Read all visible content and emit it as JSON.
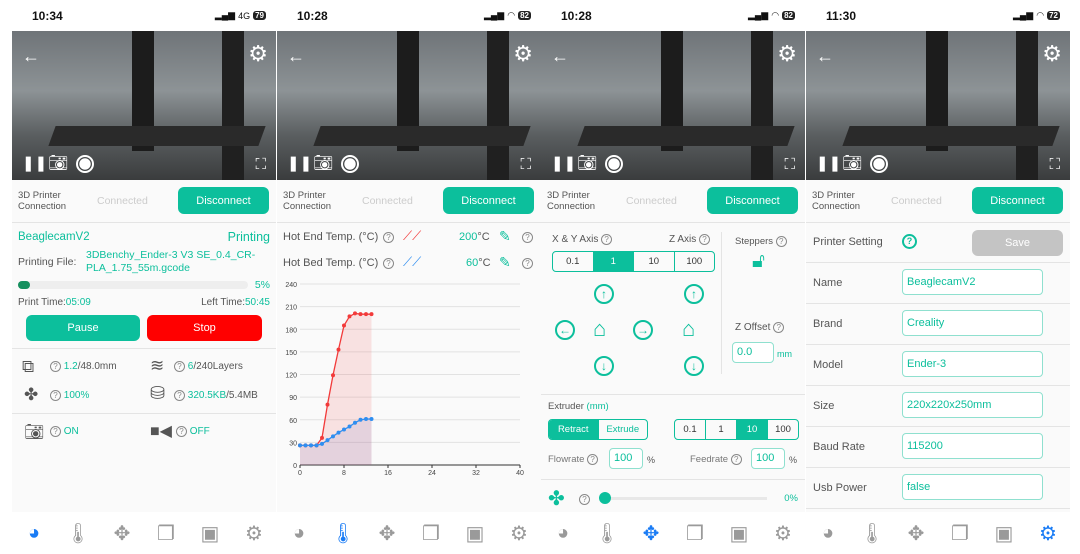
{
  "colors": {
    "accent": "#0cbf9c",
    "stop": "#ff0000",
    "nav_active": "#1a7cf5",
    "hot_end": "#f23a3a",
    "hot_bed": "#2f8ef0"
  },
  "common": {
    "conn_label": "3D Printer Connection",
    "connected": "Connected",
    "disconnect": "Disconnect",
    "nav": [
      "dashboard-icon",
      "thermometer-icon",
      "move-icon",
      "files-icon",
      "video-file-icon",
      "settings-icon"
    ]
  },
  "screens": [
    {
      "time": "10:34",
      "network": "4G",
      "battery": "79",
      "active_nav": 0
    },
    {
      "time": "10:28",
      "network": "wifi",
      "battery": "82",
      "active_nav": 1
    },
    {
      "time": "10:28",
      "network": "wifi",
      "battery": "82",
      "active_nav": 2
    },
    {
      "time": "11:30",
      "network": "wifi",
      "battery": "72",
      "active_nav": 5
    }
  ],
  "dashboard": {
    "printer_name": "BeaglecamV2",
    "status": "Printing",
    "file_label": "Printing File:",
    "file_name": "3DBenchy_Ender-3 V3 SE_0.4_CR-PLA_1.75_55m.gcode",
    "progress_percent": 5,
    "progress_text": "5%",
    "print_time_label": "Print Time:",
    "print_time": "05:09",
    "left_time_label": "Left Time:",
    "left_time": "50:45",
    "pause": "Pause",
    "stop": "Stop",
    "height_current": "1.2",
    "height_total": "/48.0mm",
    "layers_current": "6",
    "layers_total": "/240Layers",
    "fan": "100%",
    "size_current": "320.5KB",
    "size_total": "/5.4MB",
    "camera": "ON",
    "recording": "OFF"
  },
  "temperature": {
    "hot_end_label": "Hot End Temp. (°C)",
    "hot_end_value": "200",
    "hot_bed_label": "Hot Bed Temp. (°C)",
    "hot_bed_value": "60",
    "unit": "°C"
  },
  "chart_data": {
    "type": "area",
    "x_ticks": [
      0,
      8,
      16,
      24,
      32,
      40
    ],
    "y_ticks": [
      0,
      30,
      60,
      90,
      120,
      150,
      180,
      210,
      240
    ],
    "xlim": [
      0,
      40
    ],
    "ylim": [
      0,
      240
    ],
    "grid": true,
    "series": [
      {
        "name": "Hot End Temp. (°C)",
        "color": "#f23a3a",
        "x": [
          0,
          1,
          2,
          3,
          4,
          5,
          6,
          7,
          8,
          9,
          10,
          11,
          12,
          13
        ],
        "y": [
          26,
          26,
          26,
          26,
          36,
          80,
          119,
          153,
          185,
          197,
          201,
          200,
          200,
          200
        ]
      },
      {
        "name": "Hot Bed Temp. (°C)",
        "color": "#2f8ef0",
        "x": [
          0,
          1,
          2,
          3,
          4,
          5,
          6,
          7,
          8,
          9,
          10,
          11,
          12,
          13
        ],
        "y": [
          26,
          26,
          26,
          26,
          28,
          33,
          38,
          43,
          47,
          51,
          56,
          60,
          61,
          61
        ]
      }
    ]
  },
  "control": {
    "xy_label": "X & Y Axis",
    "z_label": "Z Axis",
    "steps": [
      "0.1",
      "1",
      "10",
      "100"
    ],
    "step_active": 1,
    "steppers": "Steppers",
    "z_offset_label": "Z Offset",
    "z_offset": "0.0",
    "mm": "mm",
    "extruder": "Extruder",
    "extruder_unit": "(mm)",
    "retract": "Retract",
    "extrude": "Extrude",
    "ext_steps": [
      "0.1",
      "1",
      "10",
      "100"
    ],
    "ext_step_active": 2,
    "flowrate_label": "Flowrate",
    "flowrate": "100",
    "feedrate_label": "Feedrate",
    "feedrate": "100",
    "percent": "%",
    "fan_speed": "0%",
    "fan_value": 0
  },
  "settings": {
    "title": "Printer Setting",
    "save": "Save",
    "fields": [
      {
        "label": "Name",
        "value": "BeaglecamV2"
      },
      {
        "label": "Brand",
        "value": "Creality"
      },
      {
        "label": "Model",
        "value": "Ender-3"
      },
      {
        "label": "Size",
        "value": "220x220x250mm"
      },
      {
        "label": "Baud Rate",
        "value": "115200"
      },
      {
        "label": "Usb Power",
        "value": "false"
      }
    ]
  }
}
